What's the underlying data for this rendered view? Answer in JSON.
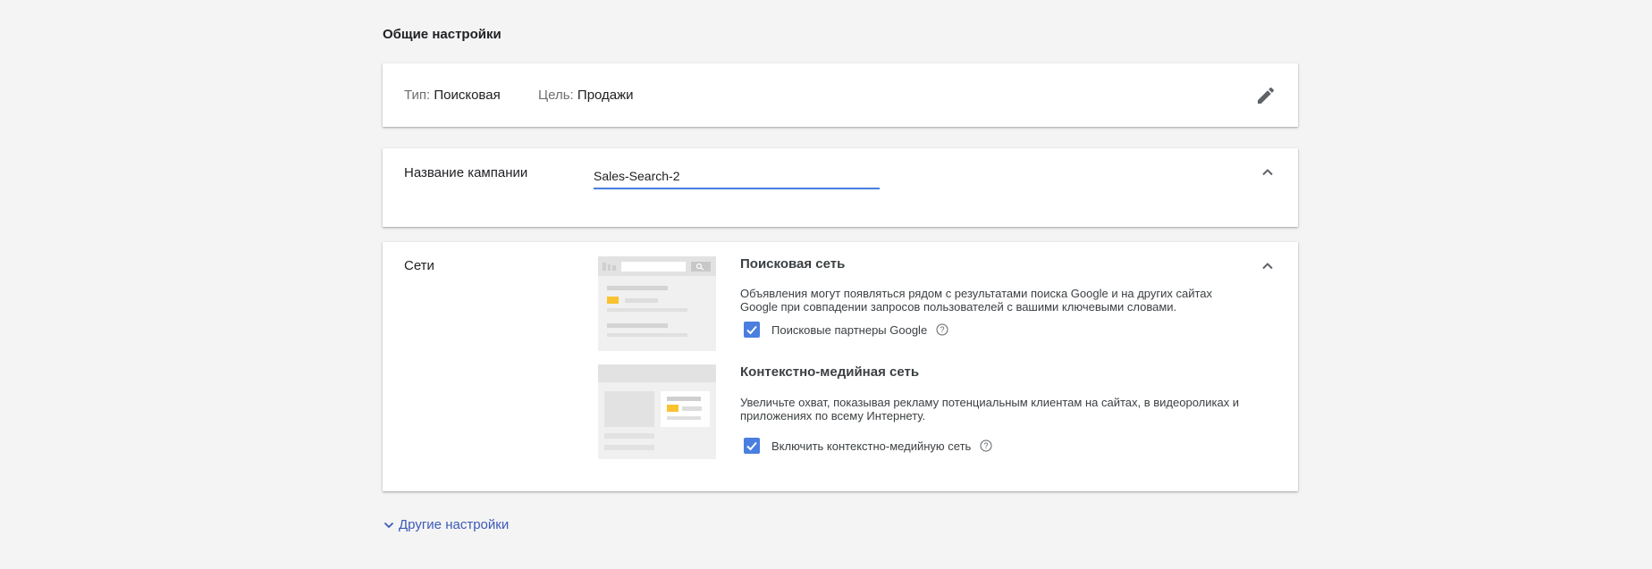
{
  "section": {
    "title": "Общие настройки"
  },
  "summary": {
    "type_label": "Тип:",
    "type_value": "Поисковая",
    "goal_label": "Цель:",
    "goal_value": "Продажи"
  },
  "campaign_name": {
    "label": "Название кампании",
    "value": "Sales-Search-2"
  },
  "networks": {
    "label": "Сети",
    "search": {
      "title": "Поисковая сеть",
      "description": "Объявления могут появляться рядом с результатами поиска Google и на других сайтах Google при совпадении запросов пользователей с вашими ключевыми словами.",
      "checkbox_label": "Поисковые партнеры Google",
      "checked": true
    },
    "display": {
      "title": "Контекстно-медийная сеть",
      "description": "Увеличьте охват, показывая рекламу потенциальным клиентам на сайтах, в видеороликах и приложениях по всему Интернету.",
      "checkbox_label": "Включить контекстно-медийную сеть",
      "checked": true
    }
  },
  "more_settings": {
    "label": "Другие настройки"
  },
  "colors": {
    "accent": "#4a7ee0",
    "link": "#3c5bb8",
    "highlight": "#f9c22e",
    "background": "#f4f4f4"
  },
  "icons": [
    "pencil-icon",
    "chevron-up-icon",
    "check-icon",
    "help-icon",
    "chevron-down-icon"
  ]
}
